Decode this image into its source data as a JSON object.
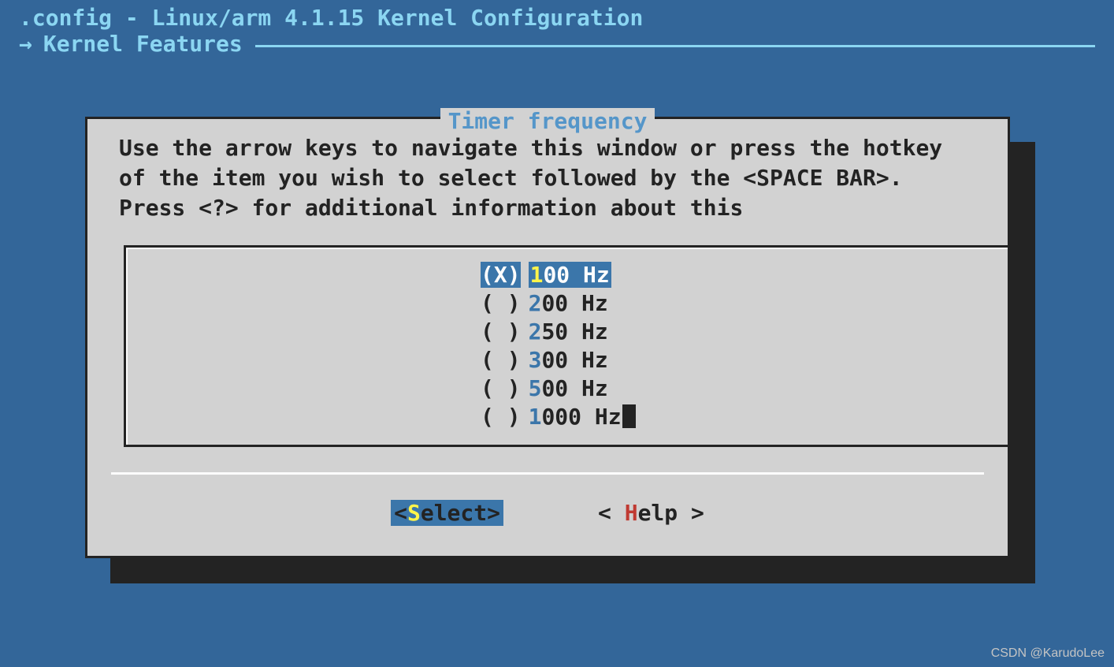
{
  "header": {
    "title": ".config - Linux/arm 4.1.15 Kernel Configuration",
    "breadcrumb_arrow": "→",
    "breadcrumb": "Kernel Features"
  },
  "dialog": {
    "title": "Timer frequency",
    "instructions": "Use the arrow keys to navigate this window or press the hotkey of the item you wish to select followed by the <SPACE BAR>. Press <?> for additional information about this",
    "options": [
      {
        "marker": "(X)",
        "hotkey": "1",
        "rest": "00 Hz",
        "selected": true,
        "cursor": false
      },
      {
        "marker": "( )",
        "hotkey": "2",
        "rest": "00 Hz",
        "selected": false,
        "cursor": false
      },
      {
        "marker": "( )",
        "hotkey": "2",
        "rest": "50 Hz",
        "selected": false,
        "cursor": false
      },
      {
        "marker": "( )",
        "hotkey": "3",
        "rest": "00 Hz",
        "selected": false,
        "cursor": false
      },
      {
        "marker": "( )",
        "hotkey": "5",
        "rest": "00 Hz",
        "selected": false,
        "cursor": false
      },
      {
        "marker": "( )",
        "hotkey": "1",
        "rest": "000 Hz",
        "selected": false,
        "cursor": true
      }
    ],
    "buttons": {
      "select": {
        "open": "<",
        "hot": "S",
        "rest": "elect",
        "close": ">"
      },
      "help": {
        "open": "< ",
        "hot": "H",
        "rest": "elp ",
        "close": ">"
      }
    }
  },
  "watermark": "CSDN @KarudoLee"
}
